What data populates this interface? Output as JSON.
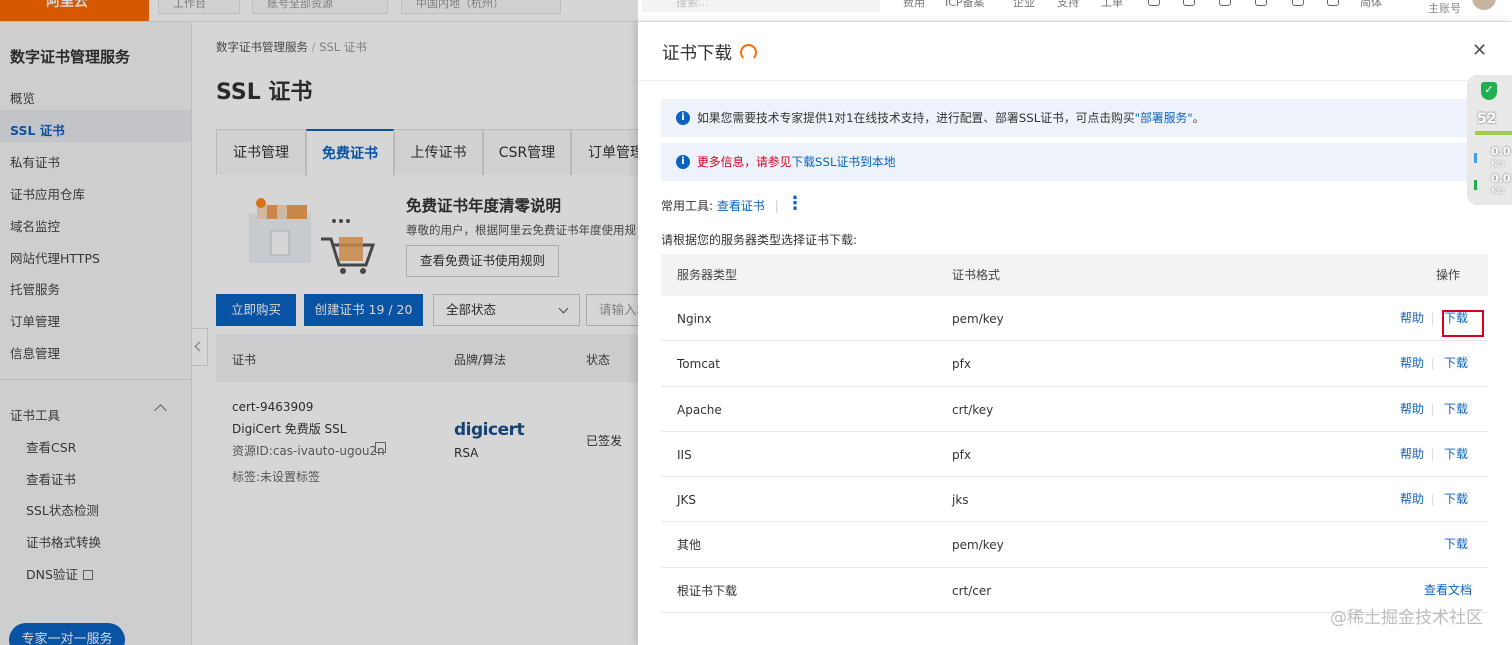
{
  "topbar": {
    "logo": "阿里云",
    "workbench": "工作台",
    "account": "账号全部资源",
    "region": "中国内地（杭州）",
    "search_placeholder": "搜索...",
    "nav": [
      "费用",
      "ICP备案",
      "企业",
      "支持",
      "工单"
    ],
    "lang": "简体",
    "sub_account": "主账号"
  },
  "sidebar": {
    "title": "数字证书管理服务",
    "items": [
      "概览",
      "SSL 证书",
      "私有证书",
      "证书应用仓库",
      "域名监控",
      "网站代理HTTPS",
      "托管服务",
      "订单管理",
      "信息管理"
    ],
    "tools_title": "证书工具",
    "tools": [
      "查看CSR",
      "查看证书",
      "SSL状态检测",
      "证书格式转换",
      "DNS验证"
    ],
    "expert_btn": "专家一对一服务"
  },
  "main": {
    "breadcrumb_root": "数字证书管理服务",
    "breadcrumb_current": "SSL 证书",
    "title": "SSL 证书",
    "tabs": [
      "证书管理",
      "免费证书",
      "上传证书",
      "CSR管理",
      "订单管理"
    ],
    "banner_title": "免费证书年度清零说明",
    "banner_desc": "尊敬的用户，根据阿里云免费证书年度使用规",
    "rule_btn": "查看免费证书使用规则",
    "buy_btn": "立即购买",
    "create_btn": "创建证书 19 / 20",
    "status_select": "全部状态",
    "search_placeholder": "请输入域名",
    "table_headers": [
      "证书",
      "品牌/算法",
      "状态"
    ],
    "cert": {
      "name": "cert-9463909",
      "type": "DigiCert 免费版 SSL",
      "resource_id": "资源ID:cas-ivauto-ugou2n",
      "tag": "标签:未设置标签",
      "brand": "digicert",
      "algo": "RSA",
      "status": "已签发"
    }
  },
  "drawer": {
    "title": "证书下载",
    "info1_text": "如果您需要技术专家提供1对1在线技术支持，进行配置、部署SSL证书，可点击购买",
    "info1_link": "\"部署服务\"",
    "info1_end": "。",
    "info2_red": "更多信息，请参见",
    "info2_link": "下载SSL证书到本地",
    "tools_label": "常用工具:",
    "tools_link": "查看证书",
    "choose_text": "请根据您的服务器类型选择证书下载:",
    "table_headers": {
      "server": "服务器类型",
      "format": "证书格式",
      "action": "操作"
    },
    "rows": [
      {
        "server": "Nginx",
        "format": "pem/key",
        "help": "帮助",
        "download": "下载"
      },
      {
        "server": "Tomcat",
        "format": "pfx",
        "help": "帮助",
        "download": "下载"
      },
      {
        "server": "Apache",
        "format": "crt/key",
        "help": "帮助",
        "download": "下载"
      },
      {
        "server": "IIS",
        "format": "pfx",
        "help": "帮助",
        "download": "下载"
      },
      {
        "server": "JKS",
        "format": "jks",
        "help": "帮助",
        "download": "下载"
      },
      {
        "server": "其他",
        "format": "pem/key",
        "help": "",
        "download": "下载"
      },
      {
        "server": "根证书下载",
        "format": "crt/cer",
        "help": "",
        "download": "查看文档"
      }
    ]
  },
  "net_widget": {
    "percent": "52",
    "up": "0.0",
    "up_unit": "K/s",
    "down": "0.0",
    "down_unit": "K/s"
  },
  "watermark": "@稀土掘金技术社区",
  "colors": {
    "accent": "#0b63c4",
    "brand": "#ff6a00",
    "highlight": "#d9001b"
  }
}
